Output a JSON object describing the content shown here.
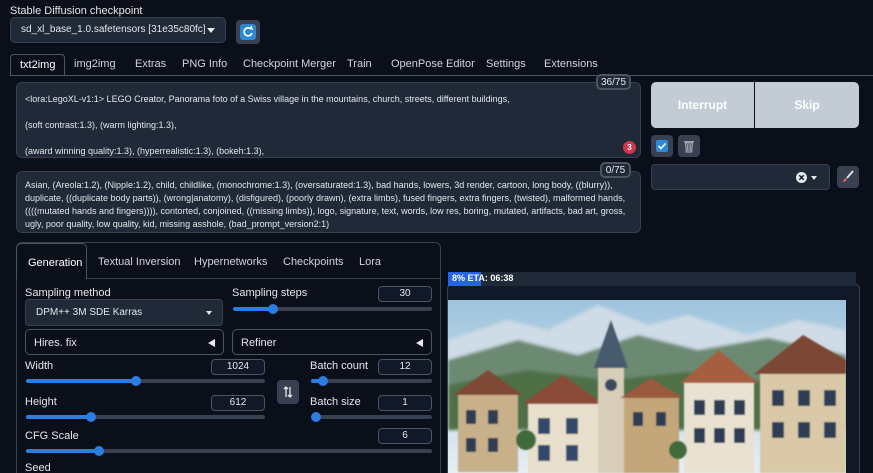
{
  "checkpoint": {
    "label": "Stable Diffusion checkpoint",
    "value": "sd_xl_base_1.0.safetensors [31e35c80fc]"
  },
  "icons": {
    "refresh": "refresh-icon",
    "check": "checkbox-icon",
    "trash": "trash-icon",
    "brush": "paintbrush-icon",
    "close": "close-icon",
    "swap": "swap-icon"
  },
  "tabs": [
    "txt2img",
    "img2img",
    "Extras",
    "PNG Info",
    "Checkpoint Merger",
    "Train",
    "OpenPose Editor",
    "Settings",
    "Extensions"
  ],
  "prompt": {
    "counter": "36/75",
    "line1": "<lora:LegoXL-v1:1> LEGO Creator, Panorama foto of a Swiss village in the mountains, church, streets, different buildings,",
    "line2": "(soft contrast:1.3), (warm lighting:1.3),",
    "line3": "(award winning quality:1.3), (hyperrealistic:1.3), (bokeh:1.3),",
    "badge": "3"
  },
  "negative": {
    "counter": "0/75",
    "text": "Asian, (Areola:1.2), (Nipple:1.2), child, childlike, (monochrome:1.3), (oversaturated:1.3), bad hands, lowers, 3d render, cartoon, long body, ((blurry)), duplicate, ((duplicate body parts)), (wrong|anatomy), (disfigured), (poorly drawn), (extra limbs), fused fingers, extra fingers, (twisted), malformed hands, ((((mutated hands and fingers)))), contorted, conjoined, ((missing limbs)), logo, signature, text, words, low res, boring, mutated, artifacts, bad art, gross, ugly, poor quality, low quality, kid, missing asshole, (bad_prompt_version2:1)"
  },
  "actions": {
    "interrupt": "Interrupt",
    "skip": "Skip"
  },
  "subtabs": [
    "Generation",
    "Textual Inversion",
    "Hypernetworks",
    "Checkpoints",
    "Lora"
  ],
  "generation": {
    "sampling_method_label": "Sampling method",
    "sampling_method": "DPM++ 3M SDE Karras",
    "sampling_steps_label": "Sampling steps",
    "sampling_steps": "30",
    "hires_fix": "Hires. fix",
    "refiner": "Refiner",
    "width_label": "Width",
    "width": "1024",
    "height_label": "Height",
    "height": "612",
    "batch_count_label": "Batch count",
    "batch_count": "12",
    "batch_size_label": "Batch size",
    "batch_size": "1",
    "cfg_label": "CFG Scale",
    "cfg": "6",
    "seed_label": "Seed"
  },
  "sliders": {
    "sampling_steps": 0.2,
    "width": 0.46,
    "height": 0.27,
    "batch_count": 0.1,
    "batch_size": 0.0,
    "cfg": 0.18
  },
  "progress": {
    "text": "8% ETA: 06:38",
    "fraction": 0.08
  },
  "colors": {
    "accent": "#2b7de0",
    "badge": "#d1344c",
    "button": "#c3ccd5"
  }
}
